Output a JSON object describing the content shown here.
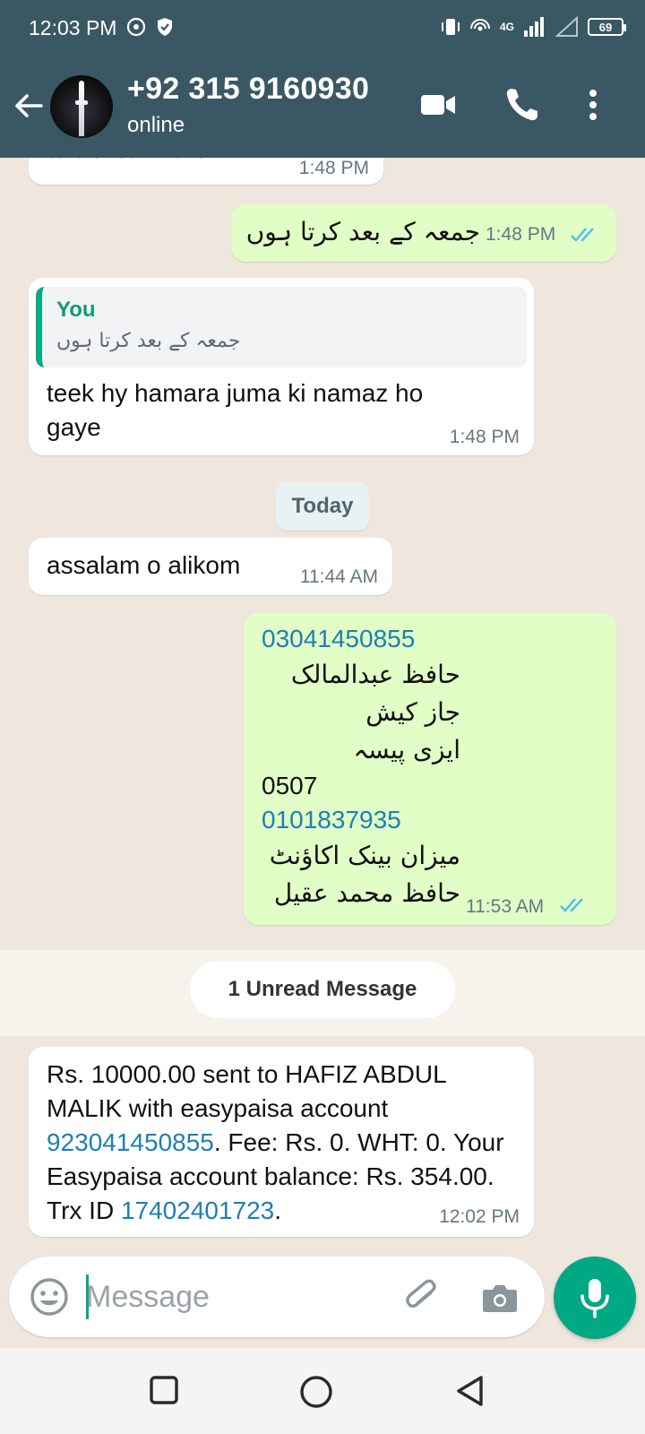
{
  "status_bar": {
    "time": "12:03 PM",
    "network": "4G",
    "battery": "69"
  },
  "header": {
    "contact_name": "+92 315 9160930",
    "contact_status": "online"
  },
  "messages": [
    {
      "id": "m1",
      "direction": "incoming",
      "text": "to abi call karo???",
      "time": "1:48 PM"
    },
    {
      "id": "m2",
      "direction": "outgoing",
      "text": "جمعہ کے بعد کرتا ہوں",
      "time": "1:48 PM",
      "read": true
    },
    {
      "id": "m3",
      "direction": "incoming",
      "reply_to": {
        "author": "You",
        "text": "جمعہ کے بعد کرتا ہوں"
      },
      "text": "teek hy hamara juma ki namaz ho gaye",
      "time": "1:48 PM"
    },
    {
      "id": "m4",
      "direction": "incoming",
      "text": "assalam o alikom",
      "time": "11:44 AM"
    },
    {
      "id": "m5",
      "direction": "outgoing",
      "lines": [
        "03041450855",
        "حافظ عبدالمالک",
        "جاز کیش",
        "ایزی پیسہ",
        "0507",
        "0101837935",
        "میزان بینک اکاؤنٹ",
        "حافظ محمد عقیل"
      ],
      "time": "11:53 AM",
      "read": true
    },
    {
      "id": "m6",
      "direction": "incoming",
      "parts": [
        "Rs. 10000.00 sent to HAFIZ ABDUL MALIK with easypaisa account ",
        "923041450855",
        ". Fee: Rs. 0. WHT: 0. Your Easypaisa account balance: Rs. 354.00. Trx ID ",
        "17402401723",
        "."
      ],
      "time": "12:02 PM"
    }
  ],
  "date_separator": "Today",
  "unread_banner": "1 Unread Message",
  "compose": {
    "placeholder": "Message"
  },
  "colors": {
    "header_bg": "#3a5864",
    "chat_bg": "#efe7dd",
    "outgoing_bubble": "#e1fec6",
    "accent": "#00a884",
    "link": "#1d7fb3",
    "read_ticks": "#53bdeb"
  },
  "icons": [
    "back-arrow-icon",
    "video-call-icon",
    "phone-icon",
    "more-options-icon",
    "emoji-icon",
    "attach-icon",
    "camera-icon",
    "mic-icon",
    "nav-recents-icon",
    "nav-home-icon",
    "nav-back-icon"
  ]
}
